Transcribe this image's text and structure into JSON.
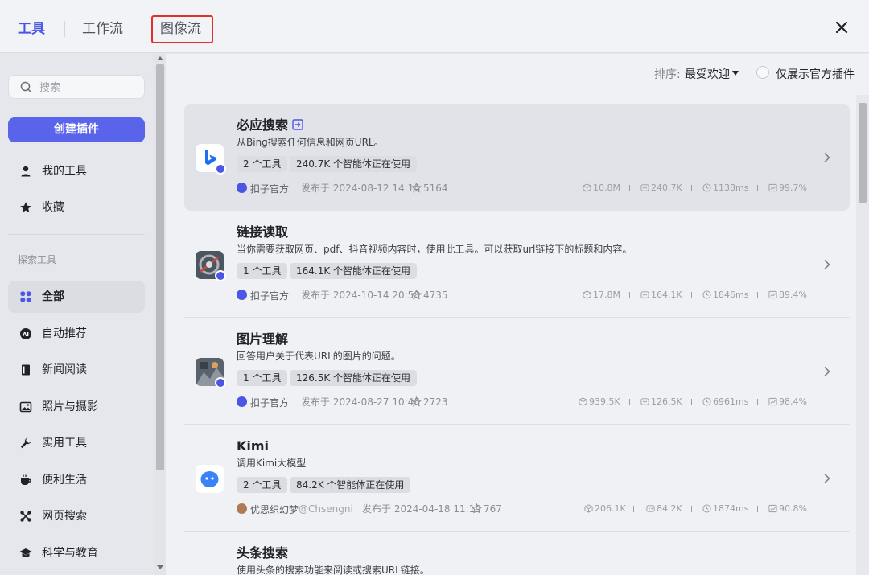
{
  "header": {
    "tabs": [
      {
        "label": "工具",
        "active": true
      },
      {
        "label": "工作流",
        "active": false
      },
      {
        "label": "图像流",
        "active": false
      }
    ],
    "close_icon": "close-icon"
  },
  "sidebar": {
    "search_placeholder": "搜索",
    "create_button": "创建插件",
    "personal": [
      {
        "label": "我的工具",
        "icon": "person-icon"
      },
      {
        "label": "收藏",
        "icon": "star-icon"
      }
    ],
    "section_label": "探索工具",
    "categories": [
      {
        "label": "全部",
        "icon": "grid-icon",
        "selected": true
      },
      {
        "label": "自动推荐",
        "icon": "ai-icon"
      },
      {
        "label": "新闻阅读",
        "icon": "book-icon"
      },
      {
        "label": "照片与摄影",
        "icon": "image-icon"
      },
      {
        "label": "实用工具",
        "icon": "wrench-icon"
      },
      {
        "label": "便利生活",
        "icon": "cup-icon"
      },
      {
        "label": "网页搜索",
        "icon": "network-icon"
      },
      {
        "label": "科学与教育",
        "icon": "graduation-cap-icon"
      }
    ]
  },
  "toolbar": {
    "sort_label": "排序:",
    "sort_value": "最受欢迎",
    "official_only_label": "仅展示官方插件"
  },
  "plugins": [
    {
      "title": "必应搜索",
      "desc": "从Bing搜索任何信息和网页URL。",
      "tools": "2 个工具",
      "agents": "240.7K 个智能体正在使用",
      "author": "扣子官方",
      "published": "发布于 2024-08-12 14:14",
      "stars": "5164",
      "calls": "10.8M",
      "bots": "240.7K",
      "latency": "1138ms",
      "success": "99.7%"
    },
    {
      "title": "链接读取",
      "desc": "当你需要获取网页、pdf、抖音视频内容时，使用此工具。可以获取url链接下的标题和内容。",
      "tools": "1 个工具",
      "agents": "164.1K 个智能体正在使用",
      "author": "扣子官方",
      "published": "发布于 2024-10-14 20:58",
      "stars": "4735",
      "calls": "17.8M",
      "bots": "164.1K",
      "latency": "1846ms",
      "success": "89.4%"
    },
    {
      "title": "图片理解",
      "desc": "回答用户关于代表URL的图片的问题。",
      "tools": "1 个工具",
      "agents": "126.5K 个智能体正在使用",
      "author": "扣子官方",
      "published": "发布于 2024-08-27 10:46",
      "stars": "2723",
      "calls": "939.5K",
      "bots": "126.5K",
      "latency": "6961ms",
      "success": "98.4%"
    },
    {
      "title": "Kimi",
      "desc": "调用Kimi大模型",
      "tools": "2 个工具",
      "agents": "84.2K 个智能体正在使用",
      "author": "优思织幻梦",
      "handle": "@Chsengni",
      "published": "发布于 2024-04-18 11:19",
      "stars": "767",
      "calls": "206.1K",
      "bots": "84.2K",
      "latency": "1874ms",
      "success": "90.8%"
    },
    {
      "title": "头条搜索",
      "desc": "使用头条的搜索功能来阅读或搜索URL链接。"
    }
  ]
}
